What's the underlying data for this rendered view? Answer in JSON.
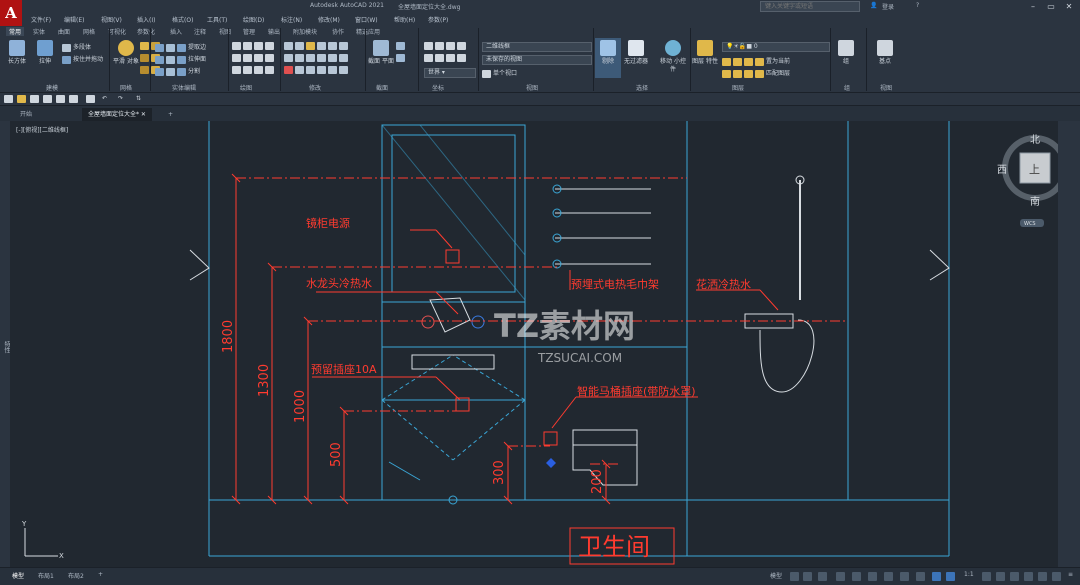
{
  "window": {
    "app_title": "Autodesk AutoCAD 2021",
    "file_title": "全屋墙面定位大全.dwg",
    "search_placeholder": "键入关键字或短语",
    "login": "登录"
  },
  "menu": [
    "文件(F)",
    "编辑(E)",
    "视图(V)",
    "插入(I)",
    "格式(O)",
    "工具(T)",
    "绘图(D)",
    "标注(N)",
    "修改(M)",
    "窗口(W)",
    "帮助(H)",
    "参数(P)"
  ],
  "ribbon": {
    "tabs": [
      "常用",
      "实体",
      "曲面",
      "网格",
      "可视化",
      "参数化",
      "插入",
      "注释",
      "视图",
      "管理",
      "输出",
      "附加模块",
      "协作",
      "精选应用"
    ],
    "active_tab": "常用",
    "buttons": {
      "box": "长方体",
      "extrude": "拉伸",
      "polysolid": "多段体",
      "presspull": "按住并拖动",
      "smooth": "平滑 对象",
      "extract_edges": "提取边",
      "extrude_face": "拉伸面",
      "separate": "分割",
      "section_plane": "截面 平面",
      "no_filter": "无过滤器",
      "move_gizmo": "移动 小控件",
      "layer_props": "图层 特性",
      "set_current": "置为当前",
      "match_layer": "匹配图层",
      "group": "组",
      "base_point": "基点",
      "cull": "剔除",
      "single_viewport": "单个视口"
    },
    "dropdowns": {
      "visual_style": "二维线框",
      "view": "未保存的视图",
      "coordinate": "世界",
      "layer": "0"
    },
    "panels": [
      "建模",
      "网格",
      "实体编辑",
      "绘图",
      "修改",
      "截面",
      "坐标",
      "视图",
      "选择",
      "图层",
      "组",
      "视图"
    ]
  },
  "filetabs": {
    "start": "开始",
    "doc": "全屋墙面定位大全*"
  },
  "viewport_label": "[-][俯视][二维线框]",
  "viewcube": {
    "north": "北",
    "south": "南",
    "east": "东",
    "west": "西",
    "top": "上",
    "wcs": "WCS"
  },
  "drawing": {
    "room_title": "卫生间",
    "annotations": {
      "mirror_cabinet": "镜柜电源",
      "faucet": "水龙头冷热水",
      "towel_rack": "预埋式电热毛巾架",
      "shower": "花洒冷热水",
      "socket": "预留插座10A",
      "toilet": "智能马桶插座(带防水罩)"
    },
    "dims": [
      "1800",
      "1300",
      "1000",
      "500",
      "300",
      "200"
    ],
    "watermark_main": "TZ素材网",
    "watermark_sub": "TZSUCAI.COM"
  },
  "statusbar": {
    "tabs": [
      "模型",
      "布局1",
      "布局2"
    ],
    "model": "模型",
    "scale": "1:1"
  },
  "colors": {
    "dim": "#ff3b2f",
    "line": "#3aa6d6",
    "white": "#d8dde2",
    "bg": "#212830"
  }
}
